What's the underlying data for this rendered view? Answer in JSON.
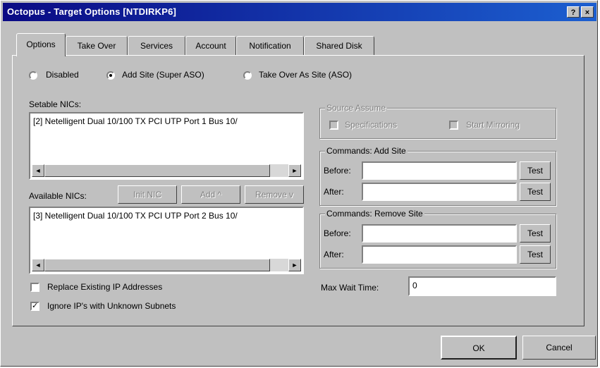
{
  "window": {
    "title": "Octopus - Target Options [NTDIRKP6]",
    "help_label": "?",
    "close_label": "×"
  },
  "tabs": [
    {
      "label": "Options",
      "active": true
    },
    {
      "label": "Take Over"
    },
    {
      "label": "Services"
    },
    {
      "label": "Account"
    },
    {
      "label": "Notification"
    },
    {
      "label": "Shared Disk"
    }
  ],
  "mode": {
    "options": [
      {
        "label": "Disabled",
        "selected": false
      },
      {
        "label": "Add Site (Super ASO)",
        "selected": true
      },
      {
        "label": "Take Over As Site (ASO)",
        "selected": false
      }
    ]
  },
  "setable_nics": {
    "label": "Setable NICs:",
    "items": [
      "[2] Netelligent Dual 10/100 TX PCI UTP Port 1 Bus 10/"
    ]
  },
  "available_nics": {
    "label": "Available NICs:",
    "items": [
      "[3] Netelligent Dual 10/100 TX PCI UTP Port 2 Bus 10/"
    ],
    "buttons": {
      "init_nic": "Init NIC",
      "add": "Add ^",
      "remove": "Remove v"
    }
  },
  "scroll": {
    "left": "◄",
    "right": "►"
  },
  "options": {
    "replace_ip": {
      "label": "Replace Existing IP Addresses",
      "checked": false
    },
    "ignore_ips": {
      "label": "Ignore IP's with Unknown Subnets",
      "checked": true
    }
  },
  "source_assume": {
    "label": "Source Assume",
    "specifications": {
      "label": "Specifications",
      "checked": false
    },
    "start_mirroring": {
      "label": "Start Mirroring",
      "checked": false
    }
  },
  "commands_add_site": {
    "label": "Commands: Add Site",
    "before_label": "Before:",
    "after_label": "After:",
    "before_value": "",
    "after_value": "",
    "test_label": "Test"
  },
  "commands_remove_site": {
    "label": "Commands: Remove Site",
    "before_label": "Before:",
    "after_label": "After:",
    "before_value": "",
    "after_value": "",
    "test_label": "Test"
  },
  "max_wait": {
    "label": "Max Wait Time:",
    "value": "0"
  },
  "footer": {
    "ok": "OK",
    "cancel": "Cancel"
  }
}
